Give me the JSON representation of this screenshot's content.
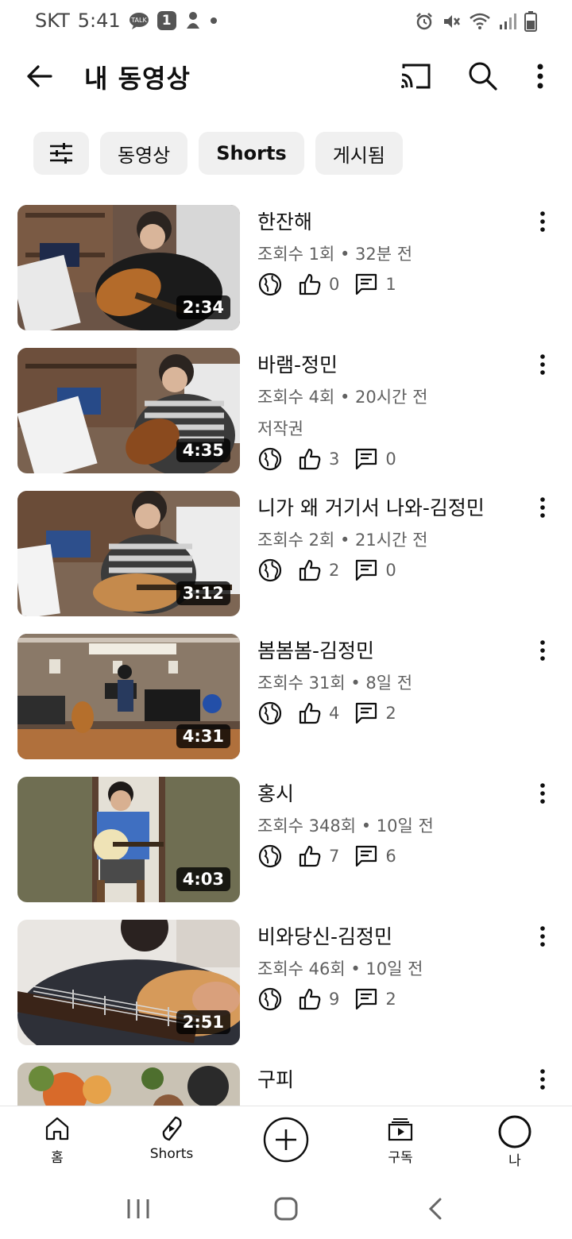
{
  "status_bar": {
    "carrier": "SKT",
    "time": "5:41",
    "notification_count": "1",
    "icons": [
      "talk-icon",
      "badge-count-icon",
      "app-icon",
      "dot-icon",
      "alarm-icon",
      "mute-icon",
      "wifi-icon",
      "signal-icon",
      "battery-icon"
    ]
  },
  "appbar": {
    "title": "내 동영상",
    "icons": [
      "back-arrow-icon",
      "cast-icon",
      "search-icon",
      "more-vert-icon"
    ]
  },
  "chips": [
    "동영상",
    "Shorts",
    "게시됨"
  ],
  "videos": [
    {
      "title": "한잔해",
      "meta": "조회수 1회 • 32분 전",
      "extra": "",
      "likes": "0",
      "comments": "1",
      "duration": "2:34"
    },
    {
      "title": "바램-정민",
      "meta": "조회수 4회 • 20시간 전",
      "extra": "저작권",
      "likes": "3",
      "comments": "0",
      "duration": "4:35"
    },
    {
      "title": "니가 왜 거기서 나와-김정민",
      "meta": "조회수 2회 • 21시간 전",
      "extra": "",
      "likes": "2",
      "comments": "0",
      "duration": "3:12"
    },
    {
      "title": "봄봄봄-김정민",
      "meta": "조회수 31회 • 8일 전",
      "extra": "",
      "likes": "4",
      "comments": "2",
      "duration": "4:31"
    },
    {
      "title": "홍시",
      "meta": "조회수 348회 • 10일 전",
      "extra": "",
      "likes": "7",
      "comments": "6",
      "duration": "4:03"
    },
    {
      "title": "비와당신-김정민",
      "meta": "조회수 46회 • 10일 전",
      "extra": "",
      "likes": "9",
      "comments": "2",
      "duration": "2:51"
    },
    {
      "title": "구피",
      "meta": "",
      "extra": "",
      "likes": "",
      "comments": "",
      "duration": ""
    }
  ],
  "bottom_nav": {
    "home": "홈",
    "shorts": "Shorts",
    "subscriptions": "구독",
    "you": "나"
  },
  "colors": {
    "text_primary": "#0f0f0f",
    "text_secondary": "#606060",
    "chip_bg": "#f0f0f0"
  }
}
